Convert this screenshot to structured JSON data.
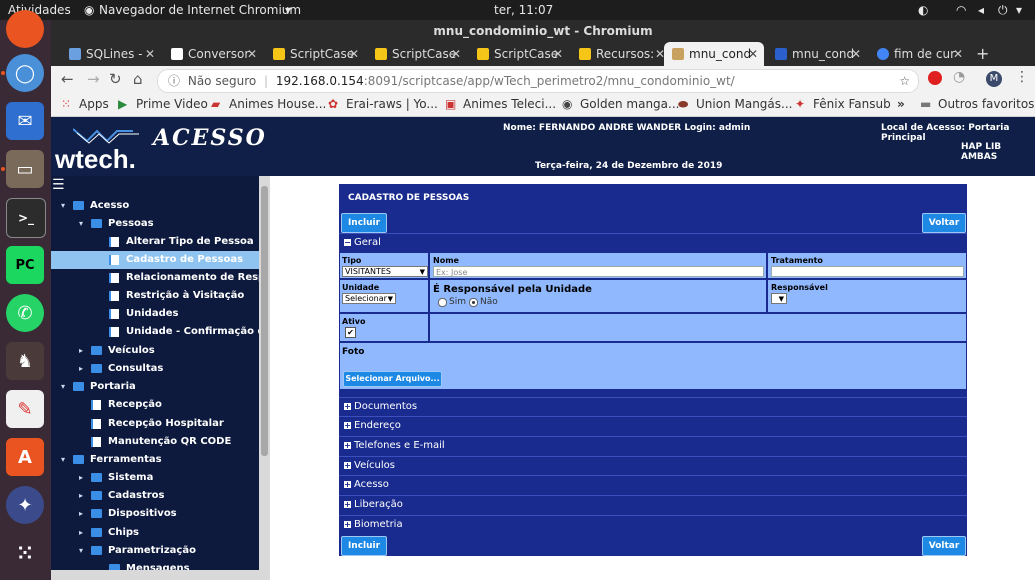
{
  "topbar": {
    "activities": "Atividades",
    "app": "Navegador de Internet Chromium",
    "clock": "ter, 11:07"
  },
  "window": {
    "title": "mnu_condominio_wt - Chromium"
  },
  "tabs": [
    {
      "label": "SQLines -",
      "color": "#6aa0e0"
    },
    {
      "label": "Conversor",
      "color": "#ffffff"
    },
    {
      "label": "ScriptCase",
      "color": "#f5c518"
    },
    {
      "label": "ScriptCase",
      "color": "#f5c518"
    },
    {
      "label": "ScriptCase",
      "color": "#f5c518"
    },
    {
      "label": "Recursos:",
      "color": "#f5c518"
    },
    {
      "label": "mnu_cond",
      "color": "#c8a060"
    },
    {
      "label": "mnu_cond",
      "color": "#2b5fcc"
    },
    {
      "label": "fim de cur",
      "color": "#4285f4"
    }
  ],
  "address": {
    "security": "Não seguro",
    "host": "192.168.0.154",
    "rest": ":8091/scriptcase/app/wTech_perimetro2/mnu_condominio_wt/",
    "profile": "M"
  },
  "bookmarks": [
    "Apps",
    "Prime Video",
    "Animes House...",
    "Erai-raws | Yo...",
    "Animes Teleci...",
    "Golden manga...",
    "Union Mangás...",
    "Fênix Fansub",
    "»",
    "Outros favoritos"
  ],
  "header": {
    "logo_text": "wtech.",
    "banner": "ACESSO",
    "user_line": "Nome: FERNANDO ANDRE WANDER Login: admin",
    "date": "Terça-feira, 24 de Dezembro de 2019",
    "local_line": "Local de Acesso: Portaria Principal",
    "company": "HAP LIB AMBAS"
  },
  "sidebar": [
    {
      "label": "Acesso",
      "level": 0,
      "kind": "folder",
      "arrow": "▾"
    },
    {
      "label": "Pessoas",
      "level": 1,
      "kind": "folder",
      "arrow": "▾"
    },
    {
      "label": "Alterar Tipo de Pessoa",
      "level": 2,
      "kind": "doc",
      "arrow": ""
    },
    {
      "label": "Cadastro de Pessoas",
      "level": 2,
      "kind": "doc",
      "arrow": "",
      "selected": true
    },
    {
      "label": "Relacionamento de Responsab",
      "level": 2,
      "kind": "doc",
      "arrow": ""
    },
    {
      "label": "Restrição à Visitação",
      "level": 2,
      "kind": "doc",
      "arrow": ""
    },
    {
      "label": "Unidades",
      "level": 2,
      "kind": "doc",
      "arrow": ""
    },
    {
      "label": "Unidade - Confirmação de Entr",
      "level": 2,
      "kind": "doc",
      "arrow": ""
    },
    {
      "label": "Veículos",
      "level": 1,
      "kind": "folder",
      "arrow": "▸"
    },
    {
      "label": "Consultas",
      "level": 1,
      "kind": "folder",
      "arrow": "▸"
    },
    {
      "label": "Portaria",
      "level": 0,
      "kind": "folder",
      "arrow": "▾"
    },
    {
      "label": "Recepção",
      "level": 1,
      "kind": "doc",
      "arrow": ""
    },
    {
      "label": "Recepção Hospitalar",
      "level": 1,
      "kind": "doc",
      "arrow": ""
    },
    {
      "label": "Manutenção QR CODE",
      "level": 1,
      "kind": "doc",
      "arrow": ""
    },
    {
      "label": "Ferramentas",
      "level": 0,
      "kind": "folder",
      "arrow": "▾"
    },
    {
      "label": "Sistema",
      "level": 1,
      "kind": "folder",
      "arrow": "▸"
    },
    {
      "label": "Cadastros",
      "level": 1,
      "kind": "folder",
      "arrow": "▸"
    },
    {
      "label": "Dispositivos",
      "level": 1,
      "kind": "folder",
      "arrow": "▸"
    },
    {
      "label": "Chips",
      "level": 1,
      "kind": "folder",
      "arrow": "▸"
    },
    {
      "label": "Parametrização",
      "level": 1,
      "kind": "folder",
      "arrow": "▾"
    },
    {
      "label": "Mensagens",
      "level": 2,
      "kind": "folder",
      "arrow": ""
    }
  ],
  "form": {
    "title": "CADASTRO DE PESSOAS",
    "incluir": "Incluir",
    "voltar": "Voltar",
    "geral": "Geral",
    "tipo_label": "Tipo",
    "tipo_value": "VISITANTES",
    "nome_label": "Nome",
    "nome_placeholder": "Ex: Jose",
    "tratamento_label": "Tratamento",
    "unidade_label": "Unidade",
    "unidade_value": "Selecionar",
    "responsavel_unidade_label": "É Responsável pela Unidade",
    "sim": "Sim",
    "nao": "Não",
    "responsavel_label": "Responsável",
    "ativo_label": "Ativo",
    "foto_label": "Foto",
    "selecionar_arquivo": "Selecionar Arquivo...",
    "sections": [
      "Documentos",
      "Endereço",
      "Telefones e E-mail",
      "Veículos",
      "Acesso",
      "Liberação",
      "Biometria"
    ]
  }
}
